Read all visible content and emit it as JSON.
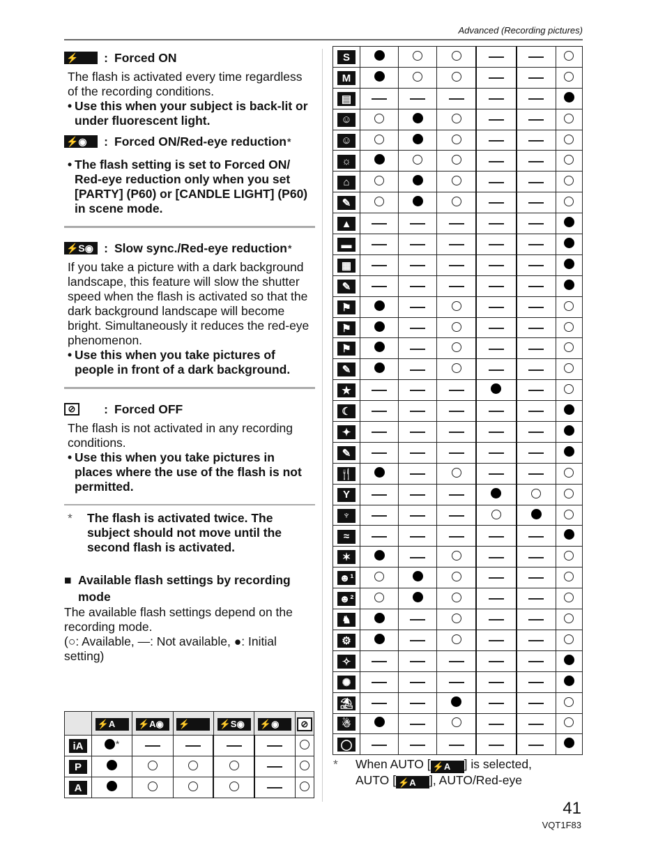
{
  "header": {
    "section": "Advanced (Recording pictures)"
  },
  "sections": [
    {
      "icon": "flash-forced-on",
      "icon_text": "⚡",
      "title": "Forced ON",
      "body": "The flash is activated every time regardless of the recording conditions.",
      "bullets": [
        "Use this when your subject is back-lit or under fluorescent light."
      ]
    },
    {
      "icon": "flash-forced-on-red-eye",
      "icon_text": "⚡◉",
      "title": "Forced ON/Red-eye reduction",
      "asterisk": "*",
      "body": "",
      "bullets": [
        "The flash setting is set to Forced ON/ Red-eye reduction only when you set [PARTY] (P60) or [CANDLE LIGHT] (P60) in scene mode."
      ]
    },
    {
      "icon": "flash-slow-sync-red-eye",
      "icon_text": "⚡S◉",
      "title": "Slow sync./Red-eye reduction",
      "asterisk": "*",
      "body": "If you take a picture with a dark background landscape, this feature will slow the shutter speed when the flash is activated so that the dark background landscape will become bright. Simultaneously it reduces the red-eye phenomenon.",
      "bullets": [
        "Use this when you take pictures of people in front of a dark background."
      ]
    },
    {
      "icon": "flash-forced-off",
      "icon_text": "⊘",
      "title": "Forced OFF",
      "body": "The flash is not activated in any recording conditions.",
      "bullets": [
        "Use this when you take pictures in places where the use of the flash is not permitted."
      ]
    }
  ],
  "colon": ":",
  "star_note": {
    "symbol": "*",
    "text": "The flash is activated twice. The subject should not move until the second flash is activated."
  },
  "available": {
    "heading": "Available flash settings by recording mode",
    "intro": "The available flash settings depend on the recording mode.",
    "legend": "(○: Available, —: Not available, ●: Initial setting)"
  },
  "table": {
    "columns": [
      {
        "icon": "flash-auto",
        "text": "⚡A"
      },
      {
        "icon": "flash-auto-red-eye",
        "text": "⚡A◉"
      },
      {
        "icon": "flash-forced-on",
        "text": "⚡"
      },
      {
        "icon": "flash-slow-sync-red-eye",
        "text": "⚡S◉"
      },
      {
        "icon": "flash-forced-on-red-eye",
        "text": "⚡◉"
      },
      {
        "icon": "flash-forced-off",
        "text": "⊘"
      }
    ],
    "legend_map": {
      "I": "Initial setting",
      "A": "Available",
      "N": "Not available"
    },
    "rows_left": [
      {
        "mode": "intelligent-auto",
        "label": "iA",
        "values": [
          "I*",
          "N",
          "N",
          "N",
          "N",
          "A"
        ]
      },
      {
        "mode": "program",
        "label": "P",
        "values": [
          "I",
          "A",
          "A",
          "A",
          "N",
          "A"
        ]
      },
      {
        "mode": "aperture-priority",
        "label": "A",
        "values": [
          "I",
          "A",
          "A",
          "A",
          "N",
          "A"
        ]
      }
    ],
    "rows_right": [
      {
        "mode": "shutter-priority",
        "label": "S",
        "values": [
          "I",
          "A",
          "A",
          "N",
          "N",
          "A"
        ]
      },
      {
        "mode": "manual",
        "label": "M",
        "values": [
          "I",
          "A",
          "A",
          "N",
          "N",
          "A"
        ]
      },
      {
        "mode": "motion-picture",
        "label": "▤",
        "values": [
          "N",
          "N",
          "N",
          "N",
          "N",
          "I"
        ]
      },
      {
        "mode": "portrait",
        "label": "☺",
        "values": [
          "A",
          "I",
          "A",
          "N",
          "N",
          "A"
        ]
      },
      {
        "mode": "soft-skin",
        "label": "☺",
        "values": [
          "A",
          "I",
          "A",
          "N",
          "N",
          "A"
        ]
      },
      {
        "mode": "outdoor-portrait",
        "label": "☼",
        "values": [
          "I",
          "A",
          "A",
          "N",
          "N",
          "A"
        ]
      },
      {
        "mode": "indoor-portrait",
        "label": "⌂",
        "values": [
          "A",
          "I",
          "A",
          "N",
          "N",
          "A"
        ]
      },
      {
        "mode": "creative-portrait",
        "label": "✎",
        "values": [
          "A",
          "I",
          "A",
          "N",
          "N",
          "A"
        ]
      },
      {
        "mode": "scenery",
        "label": "▲",
        "values": [
          "N",
          "N",
          "N",
          "N",
          "N",
          "I"
        ]
      },
      {
        "mode": "panorama-assist",
        "label": "▬",
        "values": [
          "N",
          "N",
          "N",
          "N",
          "N",
          "I"
        ]
      },
      {
        "mode": "architecture",
        "label": "▦",
        "values": [
          "N",
          "N",
          "N",
          "N",
          "N",
          "I"
        ]
      },
      {
        "mode": "creative-scenery",
        "label": "✎",
        "values": [
          "N",
          "N",
          "N",
          "N",
          "N",
          "I"
        ]
      },
      {
        "mode": "sports",
        "label": "⚑",
        "values": [
          "I",
          "N",
          "A",
          "N",
          "N",
          "A"
        ]
      },
      {
        "mode": "outdoor-sports",
        "label": "⚑",
        "values": [
          "I",
          "N",
          "A",
          "N",
          "N",
          "A"
        ]
      },
      {
        "mode": "indoor-sports",
        "label": "⚑",
        "values": [
          "I",
          "N",
          "A",
          "N",
          "N",
          "A"
        ]
      },
      {
        "mode": "creative-sports",
        "label": "✎",
        "values": [
          "I",
          "N",
          "A",
          "N",
          "N",
          "A"
        ]
      },
      {
        "mode": "night-portrait",
        "label": "★",
        "values": [
          "N",
          "N",
          "N",
          "I",
          "N",
          "A"
        ]
      },
      {
        "mode": "night-scenery",
        "label": "☾",
        "values": [
          "N",
          "N",
          "N",
          "N",
          "N",
          "I"
        ]
      },
      {
        "mode": "illuminations",
        "label": "✦",
        "values": [
          "N",
          "N",
          "N",
          "N",
          "N",
          "I"
        ]
      },
      {
        "mode": "creative-night-scenery",
        "label": "✎",
        "values": [
          "N",
          "N",
          "N",
          "N",
          "N",
          "I"
        ]
      },
      {
        "mode": "food",
        "label": "🍴",
        "values": [
          "I",
          "N",
          "A",
          "N",
          "N",
          "A"
        ]
      },
      {
        "mode": "party",
        "label": "Y",
        "values": [
          "N",
          "N",
          "N",
          "I",
          "A",
          "A"
        ]
      },
      {
        "mode": "candle-light",
        "label": "♆",
        "values": [
          "N",
          "N",
          "N",
          "A",
          "I",
          "A"
        ]
      },
      {
        "mode": "sunset",
        "label": "≈",
        "values": [
          "N",
          "N",
          "N",
          "N",
          "N",
          "I"
        ]
      },
      {
        "mode": "high-sensitivity",
        "label": "✶",
        "values": [
          "I",
          "N",
          "A",
          "N",
          "N",
          "A"
        ]
      },
      {
        "mode": "baby1",
        "label": "☻¹",
        "values": [
          "A",
          "I",
          "A",
          "N",
          "N",
          "A"
        ]
      },
      {
        "mode": "baby2",
        "label": "☻²",
        "values": [
          "A",
          "I",
          "A",
          "N",
          "N",
          "A"
        ]
      },
      {
        "mode": "pet",
        "label": "♞",
        "values": [
          "I",
          "N",
          "A",
          "N",
          "N",
          "A"
        ]
      },
      {
        "mode": "hi-speed-burst",
        "label": "⚙",
        "values": [
          "I",
          "N",
          "A",
          "N",
          "N",
          "A"
        ]
      },
      {
        "mode": "starry-sky",
        "label": "✧",
        "values": [
          "N",
          "N",
          "N",
          "N",
          "N",
          "I"
        ]
      },
      {
        "mode": "fireworks",
        "label": "✺",
        "values": [
          "N",
          "N",
          "N",
          "N",
          "N",
          "I"
        ]
      },
      {
        "mode": "beach",
        "label": "⛱",
        "values": [
          "N",
          "N",
          "I",
          "N",
          "N",
          "A"
        ]
      },
      {
        "mode": "snow",
        "label": "☃",
        "values": [
          "I",
          "N",
          "A",
          "N",
          "N",
          "A"
        ]
      },
      {
        "mode": "aerial-photo",
        "label": "◯",
        "values": [
          "N",
          "N",
          "N",
          "N",
          "N",
          "I"
        ]
      }
    ]
  },
  "footnote": {
    "symbol": "*",
    "line1_pre": "When AUTO [",
    "line1_post": "] is selected,",
    "line2_pre": "AUTO [",
    "line2_post": "], AUTO/Red-eye",
    "icon_text": "⚡A"
  },
  "page": {
    "number": "41",
    "code": "VQT1F83"
  }
}
